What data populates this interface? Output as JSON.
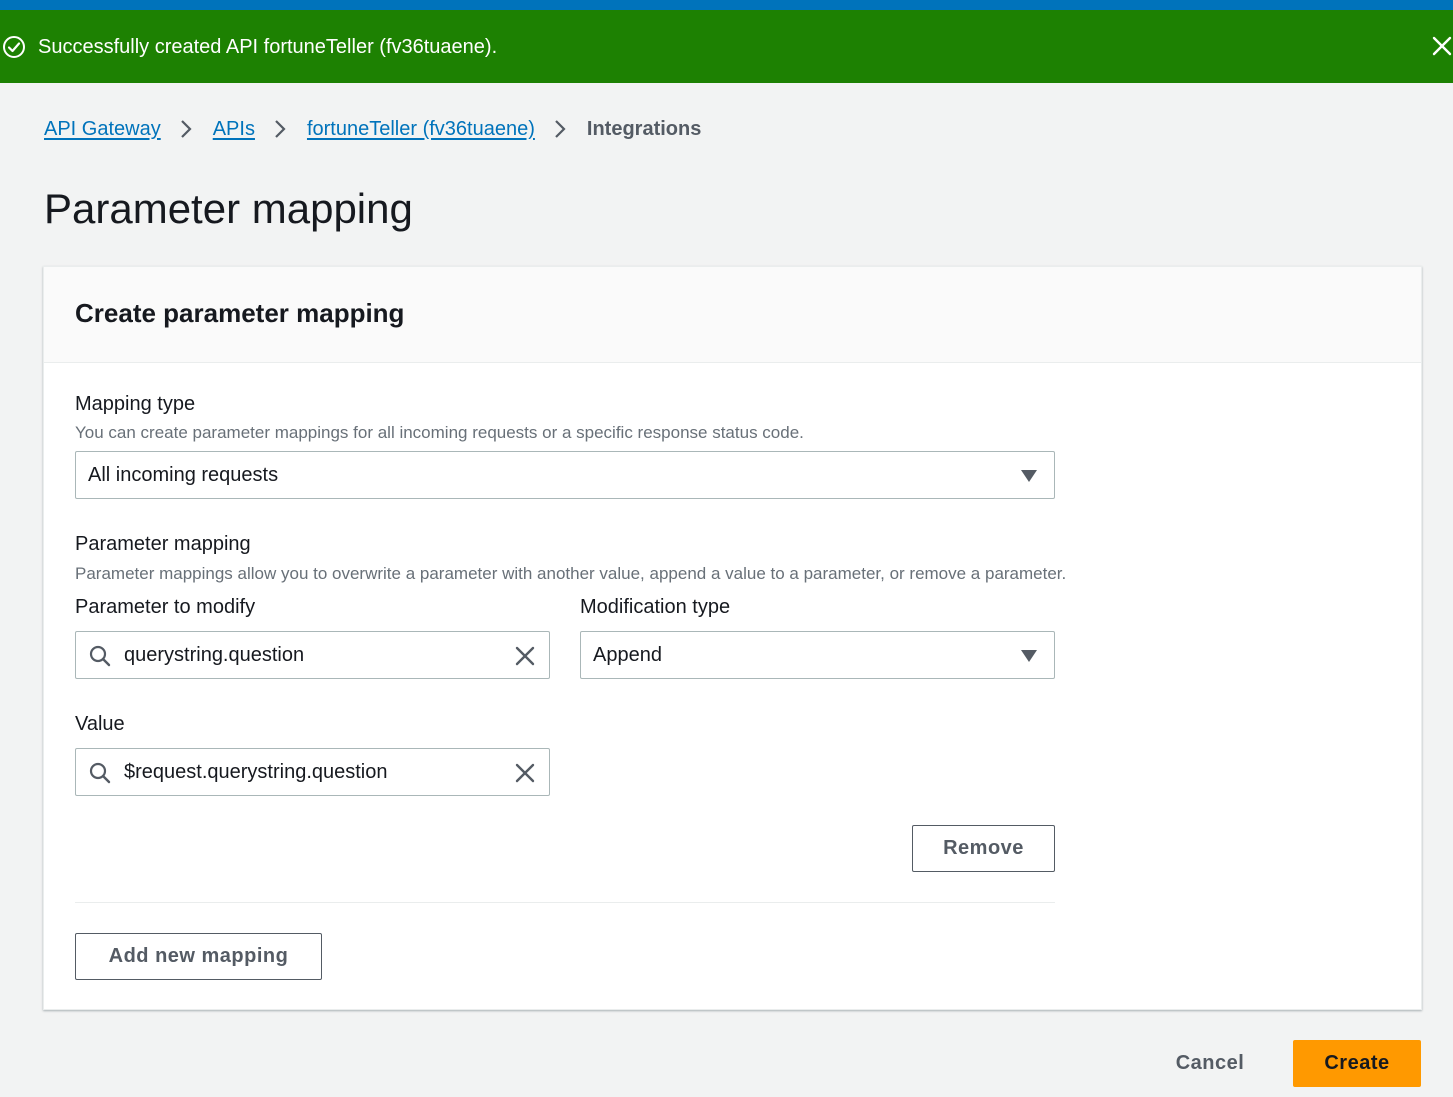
{
  "flash": {
    "message": "Successfully created API fortuneTeller (fv36tuaene).",
    "status_icon": "check-circle-icon",
    "dismiss_icon": "close-icon",
    "color": "#1d8102"
  },
  "breadcrumb": {
    "items": [
      "API Gateway",
      "APIs",
      "fortuneTeller (fv36tuaene)"
    ],
    "current": "Integrations"
  },
  "page": {
    "title": "Parameter mapping"
  },
  "panel": {
    "title": "Create parameter mapping",
    "mapping_type": {
      "label": "Mapping type",
      "description": "You can create parameter mappings for all incoming requests or a specific response status code.",
      "selected": "All incoming requests"
    },
    "parameter_mapping": {
      "label": "Parameter mapping",
      "description": "Parameter mappings allow you to overwrite a parameter with another value, append a value to a parameter, or remove a parameter.",
      "parameter_to_modify": {
        "label": "Parameter to modify",
        "value": "querystring.question"
      },
      "modification_type": {
        "label": "Modification type",
        "selected": "Append"
      },
      "value": {
        "label": "Value",
        "value": "$request.querystring.question"
      },
      "remove_label": "Remove"
    },
    "add_mapping_label": "Add new mapping"
  },
  "footer": {
    "cancel_label": "Cancel",
    "create_label": "Create",
    "primary_color": "#ff9900"
  }
}
